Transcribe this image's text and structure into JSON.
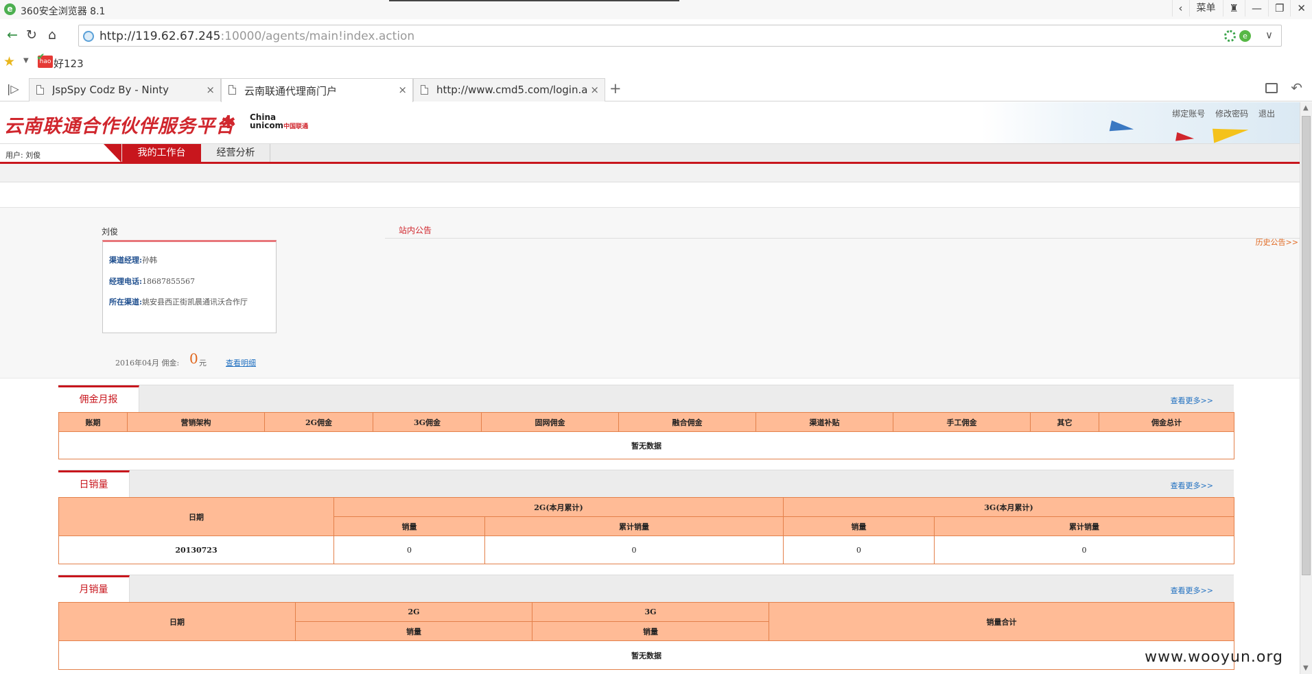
{
  "browser": {
    "title": "360安全浏览器 8.1",
    "menu_label": "菜单",
    "url_host": "http://119.62.67.245",
    "url_path": ":10000/agents/main!index.action",
    "favorite": "好123",
    "tabs": [
      {
        "label": "JspSpy Codz By - Ninty",
        "active": false
      },
      {
        "label": "云南联通代理商门户",
        "active": true
      },
      {
        "label": "http://www.cmd5.com/login.a",
        "active": false
      }
    ]
  },
  "site": {
    "logo_text": "云南联通合作伙伴服务平台",
    "unicom_en_1": "China",
    "unicom_en_2": "unicom",
    "unicom_cn": "中国联通",
    "header_links": [
      "绑定账号",
      "修改密码",
      "退出"
    ]
  },
  "nav": {
    "user_label": "用户: 刘俊",
    "tabs": [
      "我的工作台",
      "经营分析"
    ]
  },
  "profile": {
    "name": "刘俊",
    "rows": [
      {
        "key": "渠道经理:",
        "value": "孙韩"
      },
      {
        "key": "经理电话:",
        "value": "18687855567"
      },
      {
        "key": "所在渠道:",
        "value": "姚安县西正街凯晨通讯沃合作厅"
      }
    ],
    "commission_prefix": "2016年04月  佣金:",
    "commission_value": "0",
    "commission_unit": "元",
    "view_detail": "查看明细"
  },
  "notice": {
    "title": "站内公告",
    "history": "历史公告>>"
  },
  "sections": {
    "commission": {
      "tab": "佣金月报",
      "more": "查看更多>>",
      "headers": [
        "账期",
        "营销架构",
        "2G佣金",
        "3G佣金",
        "固网佣金",
        "融合佣金",
        "渠道补贴",
        "手工佣金",
        "其它",
        "佣金总计"
      ],
      "empty": "暂无数据"
    },
    "daily": {
      "tab": "日销量",
      "more": "查看更多>>",
      "date_header": "日期",
      "group_2g": "2G(本月累计)",
      "group_3g": "3G(本月累计)",
      "sales": "销量",
      "cum_sales": "累计销量",
      "row": [
        "20130723",
        "0",
        "0",
        "0",
        "0"
      ]
    },
    "monthly": {
      "tab": "月销量",
      "more": "查看更多>>",
      "date_header": "日期",
      "group_2g": "2G",
      "group_3g": "3G",
      "sales": "销量",
      "total": "销量合计",
      "empty": "暂无数据"
    }
  },
  "watermark": "www.wooyun.org"
}
